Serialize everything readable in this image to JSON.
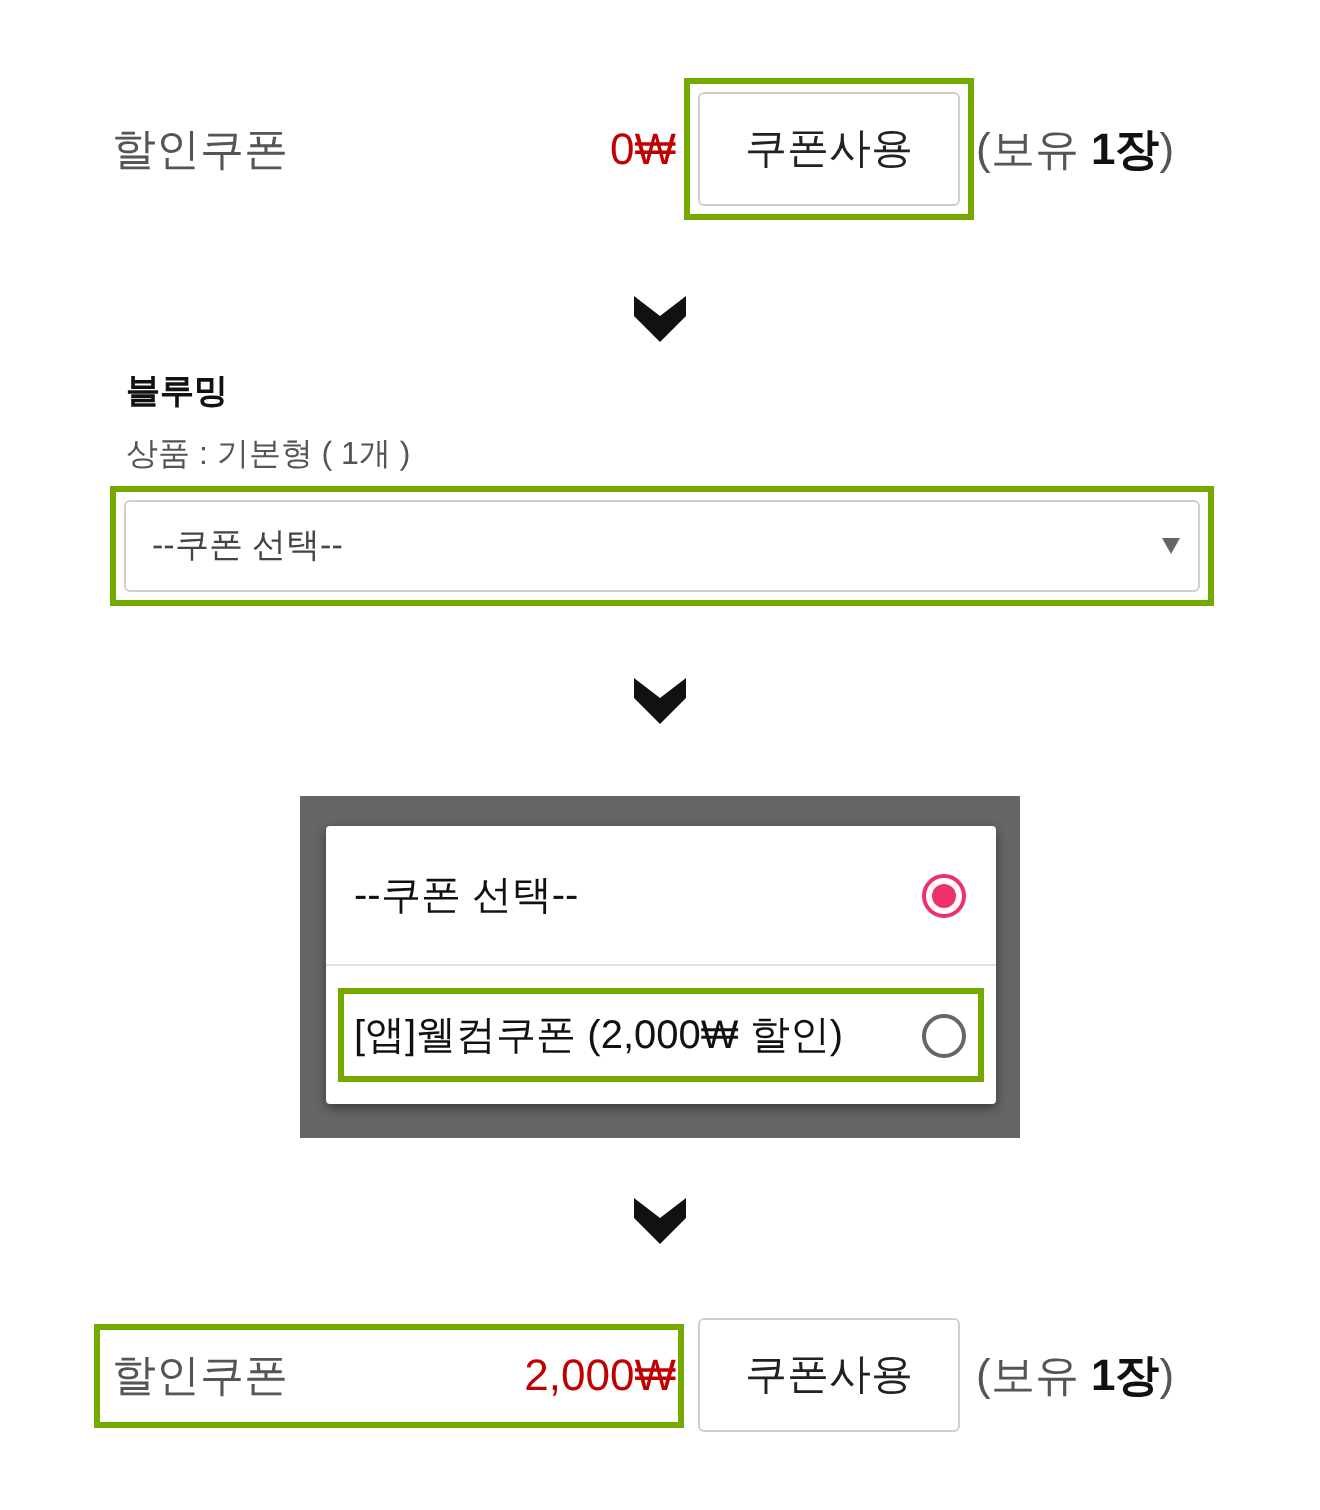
{
  "steps": [
    {
      "kind": "coupon_row",
      "label": "할인쿠폰",
      "amount": "0₩",
      "amount_highlighted": false,
      "button": "쿠폰사용",
      "button_highlighted": true,
      "owned": "(보유 **1장**)"
    },
    {
      "kind": "coupon_select",
      "product": "블루밍",
      "detail": "상품 : 기본형 ( 1개 )",
      "select_value": "--쿠폰 선택--",
      "highlighted": true
    },
    {
      "kind": "coupon_dialog",
      "options": [
        {
          "label": "--쿠폰 선택--",
          "selected": true,
          "highlighted": false
        },
        {
          "label": "[앱]웰컴쿠폰 (2,000₩ 할인)",
          "selected": false,
          "highlighted": true
        }
      ]
    },
    {
      "kind": "coupon_row",
      "label": "할인쿠폰",
      "amount": "2,000₩",
      "amount_highlighted": true,
      "button": "쿠폰사용",
      "button_highlighted": false,
      "owned": "(보유 **1장**)"
    }
  ]
}
